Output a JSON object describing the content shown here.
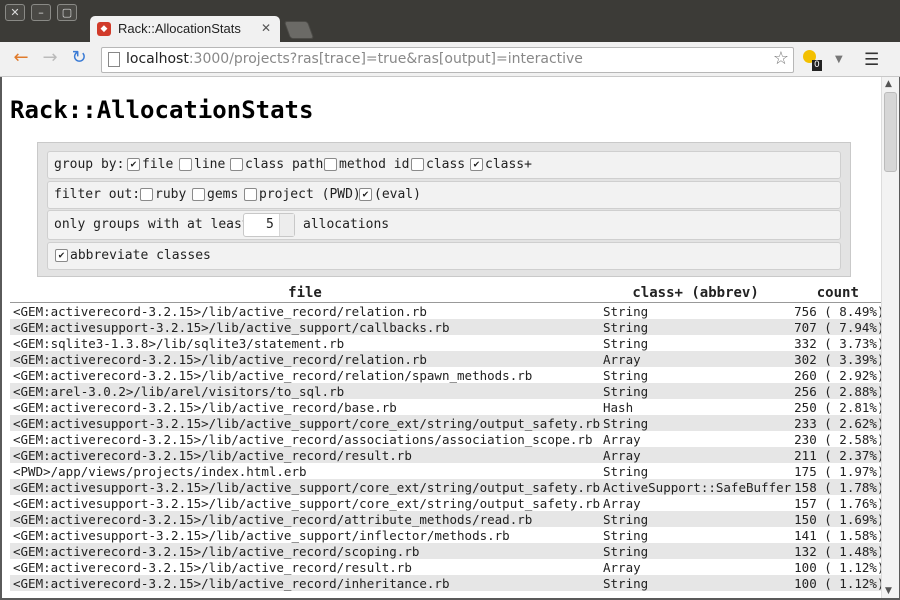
{
  "window": {
    "tab_title": "Rack::AllocationStats",
    "url_host": "localhost",
    "url_rest": ":3000/projects?ras[trace]=true&ras[output]=interactive",
    "ext_badge": "0"
  },
  "page": {
    "title": "Rack::AllocationStats"
  },
  "form": {
    "group_by": {
      "label": "group by:",
      "options": [
        {
          "label": "file",
          "checked": true
        },
        {
          "label": "line",
          "checked": false
        },
        {
          "label": "class path",
          "checked": false
        },
        {
          "label": "method id",
          "checked": false
        },
        {
          "label": "class",
          "checked": false
        },
        {
          "label": "class+",
          "checked": true
        }
      ]
    },
    "filter_out": {
      "label": "filter out:",
      "options": [
        {
          "label": "ruby",
          "checked": false
        },
        {
          "label": "gems",
          "checked": false
        },
        {
          "label": "project (PWD)",
          "checked": false
        },
        {
          "label": "(eval)",
          "checked": true
        }
      ]
    },
    "min_groups": {
      "label_before": "only groups with at least:",
      "value": "5",
      "label_after": "allocations"
    },
    "abbreviate": {
      "label": "abbreviate classes",
      "checked": true
    }
  },
  "table": {
    "headers": [
      "file",
      "class+ (abbrev)",
      "count"
    ],
    "rows": [
      [
        "<GEM:activerecord-3.2.15>/lib/active_record/relation.rb",
        "String",
        "756 ( 8.49%)"
      ],
      [
        "<GEM:activesupport-3.2.15>/lib/active_support/callbacks.rb",
        "String",
        "707 ( 7.94%)"
      ],
      [
        "<GEM:sqlite3-1.3.8>/lib/sqlite3/statement.rb",
        "String",
        "332 ( 3.73%)"
      ],
      [
        "<GEM:activerecord-3.2.15>/lib/active_record/relation.rb",
        "Array",
        "302 ( 3.39%)"
      ],
      [
        "<GEM:activerecord-3.2.15>/lib/active_record/relation/spawn_methods.rb",
        "String",
        "260 ( 2.92%)"
      ],
      [
        "<GEM:arel-3.0.2>/lib/arel/visitors/to_sql.rb",
        "String",
        "256 ( 2.88%)"
      ],
      [
        "<GEM:activerecord-3.2.15>/lib/active_record/base.rb",
        "Hash",
        "250 ( 2.81%)"
      ],
      [
        "<GEM:activesupport-3.2.15>/lib/active_support/core_ext/string/output_safety.rb",
        "String",
        "233 ( 2.62%)"
      ],
      [
        "<GEM:activerecord-3.2.15>/lib/active_record/associations/association_scope.rb",
        "Array",
        "230 ( 2.58%)"
      ],
      [
        "<GEM:activerecord-3.2.15>/lib/active_record/result.rb",
        "Array",
        "211 ( 2.37%)"
      ],
      [
        "<PWD>/app/views/projects/index.html.erb",
        "String",
        "175 ( 1.97%)"
      ],
      [
        "<GEM:activesupport-3.2.15>/lib/active_support/core_ext/string/output_safety.rb",
        "ActiveSupport::SafeBuffer",
        "158 ( 1.78%)"
      ],
      [
        "<GEM:activesupport-3.2.15>/lib/active_support/core_ext/string/output_safety.rb",
        "Array",
        "157 ( 1.76%)"
      ],
      [
        "<GEM:activerecord-3.2.15>/lib/active_record/attribute_methods/read.rb",
        "String",
        "150 ( 1.69%)"
      ],
      [
        "<GEM:activesupport-3.2.15>/lib/active_support/inflector/methods.rb",
        "String",
        "141 ( 1.58%)"
      ],
      [
        "<GEM:activerecord-3.2.15>/lib/active_record/scoping.rb",
        "String",
        "132 ( 1.48%)"
      ],
      [
        "<GEM:activerecord-3.2.15>/lib/active_record/result.rb",
        "Array",
        "100 ( 1.12%)"
      ],
      [
        "<GEM:activerecord-3.2.15>/lib/active_record/inheritance.rb",
        "String",
        "100 ( 1.12%)"
      ]
    ]
  }
}
